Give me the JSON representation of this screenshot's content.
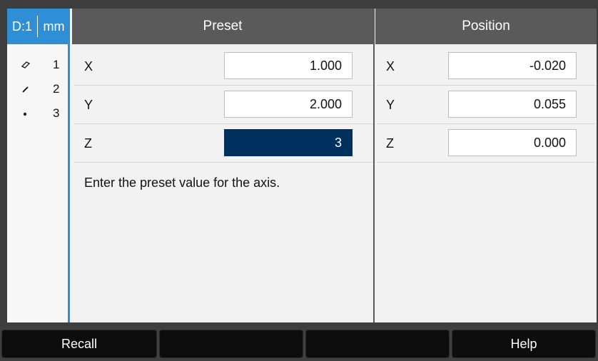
{
  "status": {
    "dro": "D:1",
    "unit": "mm"
  },
  "sidebar": {
    "items": [
      {
        "icon": "shape-outline-icon",
        "label": "1"
      },
      {
        "icon": "slash-line-icon",
        "label": "2"
      },
      {
        "icon": "dot-icon",
        "label": "3"
      }
    ]
  },
  "preset": {
    "title": "Preset",
    "rows": [
      {
        "axis": "X",
        "value": "1.000"
      },
      {
        "axis": "Y",
        "value": "2.000"
      },
      {
        "axis": "Z",
        "value": "3"
      }
    ],
    "message": "Enter the preset value for the axis."
  },
  "position": {
    "title": "Position",
    "rows": [
      {
        "axis": "X",
        "value": "-0.020"
      },
      {
        "axis": "Y",
        "value": "0.055"
      },
      {
        "axis": "Z",
        "value": "0.000"
      }
    ]
  },
  "softkeys": [
    "Recall",
    "",
    "",
    "Help"
  ],
  "colors": {
    "accent": "#2f8fd6",
    "header": "#5a5a5a",
    "active_field": "#00305e"
  }
}
